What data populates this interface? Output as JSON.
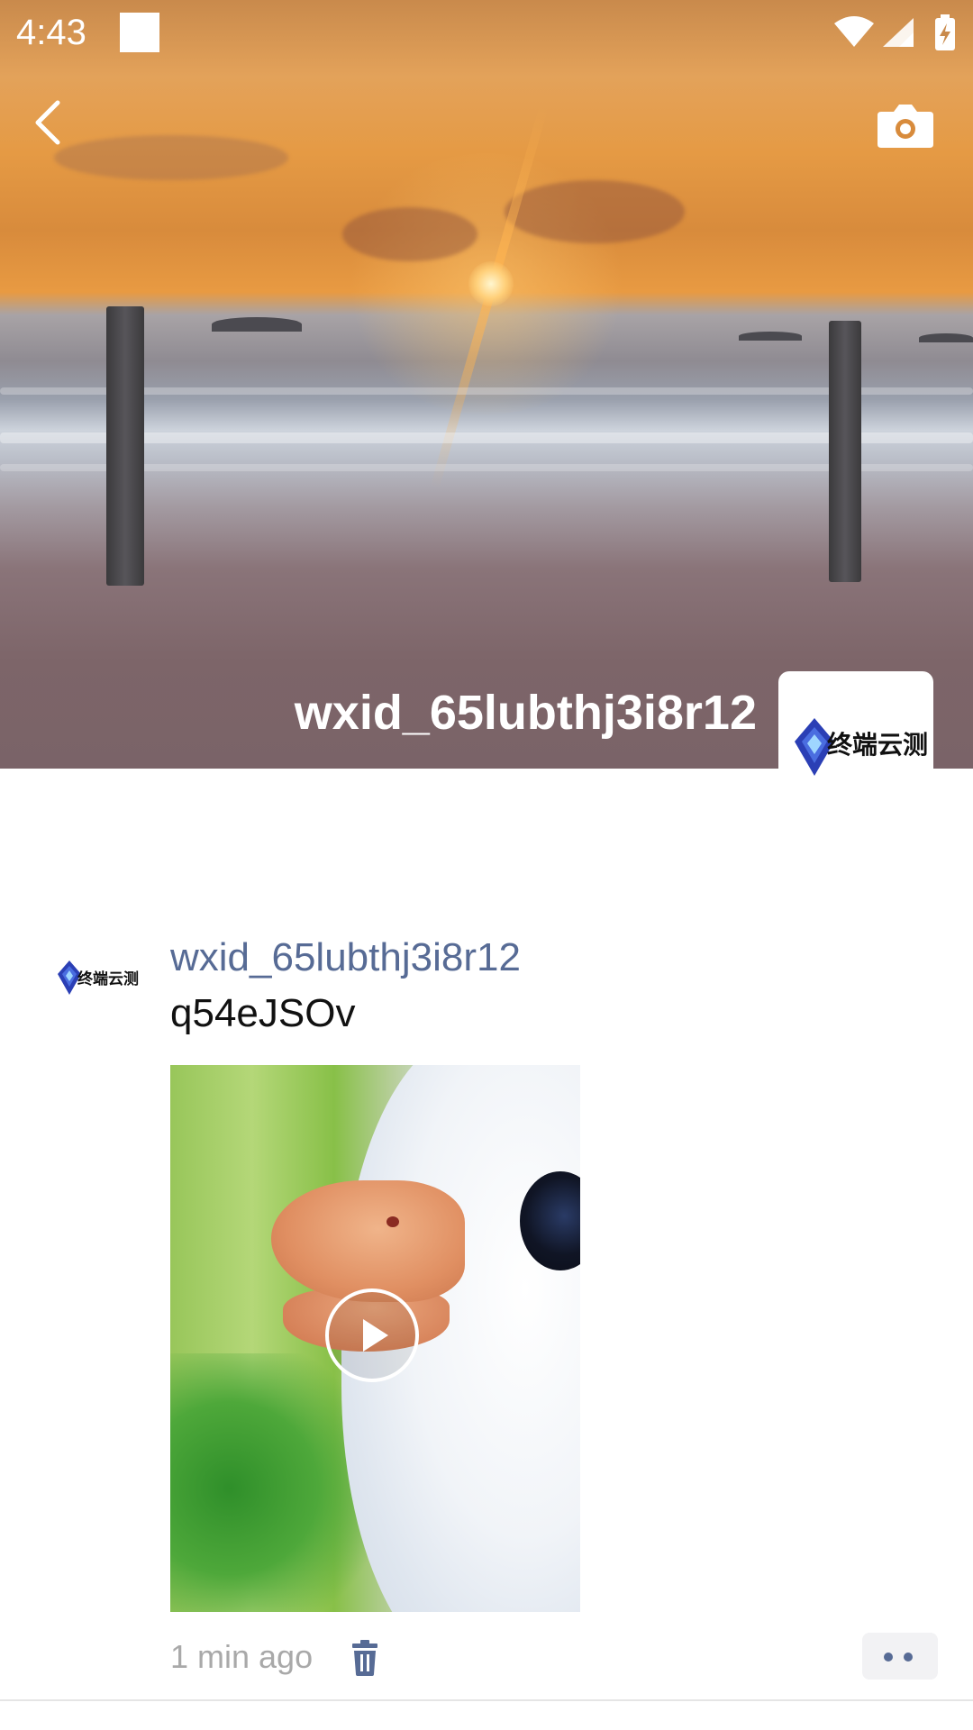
{
  "status_bar": {
    "time": "4:43"
  },
  "cover": {
    "username": "wxid_65lubthj3i8r12"
  },
  "avatar": {
    "logo_text": "终端云测"
  },
  "post": {
    "username": "wxid_65lubthj3i8r12",
    "text": "q54eJSOv",
    "time": "1 min ago"
  },
  "icons": {
    "back": "chevron-left-icon",
    "camera": "camera-icon",
    "play": "play-icon",
    "delete": "trash-icon",
    "more": "more-dots-icon"
  },
  "colors": {
    "username_link": "#576b95",
    "timestamp": "#a9a9a9",
    "logo_blue": "#2b3fb5"
  }
}
